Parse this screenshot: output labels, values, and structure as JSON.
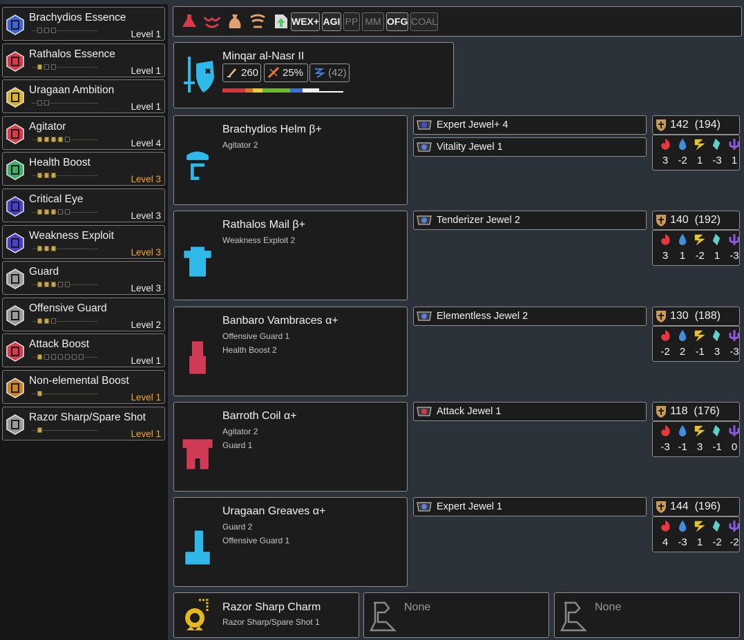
{
  "skills": [
    {
      "name": "Brachydios Essence",
      "level": "Level 1",
      "max": false,
      "pips": 3,
      "filled": 0,
      "color": "#3c63d8"
    },
    {
      "name": "Rathalos Essence",
      "level": "Level 1",
      "max": false,
      "pips": 3,
      "filled": 1,
      "color": "#d83a4c"
    },
    {
      "name": "Uragaan Ambition",
      "level": "Level 1",
      "max": false,
      "pips": 2,
      "filled": 0,
      "color": "#d7b42c"
    },
    {
      "name": "Agitator",
      "level": "Level 4",
      "max": false,
      "pips": 5,
      "filled": 4,
      "color": "#d83a4c"
    },
    {
      "name": "Health Boost",
      "level": "Level 3",
      "max": true,
      "pips": 3,
      "filled": 3,
      "color": "#3fae6b"
    },
    {
      "name": "Critical Eye",
      "level": "Level 3",
      "max": false,
      "pips": 5,
      "filled": 3,
      "color": "#4a3fc9"
    },
    {
      "name": "Weakness Exploit",
      "level": "Level 3",
      "max": true,
      "pips": 3,
      "filled": 3,
      "color": "#4a3fc9"
    },
    {
      "name": "Guard",
      "level": "Level 3",
      "max": false,
      "pips": 5,
      "filled": 3,
      "color": "#9a9a9a"
    },
    {
      "name": "Offensive Guard",
      "level": "Level 2",
      "max": false,
      "pips": 3,
      "filled": 2,
      "color": "#9a9a9a"
    },
    {
      "name": "Attack Boost",
      "level": "Level 1",
      "max": false,
      "pips": 7,
      "filled": 1,
      "color": "#d83a4c"
    },
    {
      "name": "Non-elemental Boost",
      "level": "Level 1",
      "max": true,
      "pips": 1,
      "filled": 1,
      "color": "#c8852e"
    },
    {
      "name": "Razor Sharp/Spare Shot",
      "level": "Level 1",
      "max": true,
      "pips": 1,
      "filled": 1,
      "color": "#9a9a9a"
    }
  ],
  "topbar": {
    "icons": [
      "potion-icon",
      "wing-icon",
      "sack-icon",
      "horn-icon",
      "arrow-up-icon"
    ],
    "tags": [
      {
        "label": "WEX+",
        "active": true
      },
      {
        "label": "AGI",
        "active": true
      },
      {
        "label": "PP",
        "active": false
      },
      {
        "label": "MM",
        "active": false
      },
      {
        "label": "OFG",
        "active": true
      },
      {
        "label": "COAL",
        "active": false
      }
    ]
  },
  "weapon": {
    "name": "Minqar al-Nasr II",
    "attack": "260",
    "affinity": "25%",
    "element": "(42)",
    "sharpness": [
      {
        "color": "#d0383e",
        "fraction": 0.19
      },
      {
        "color": "#d6762d",
        "fraction": 0.06
      },
      {
        "color": "#e7cf3d",
        "fraction": 0.08
      },
      {
        "color": "#6db837",
        "fraction": 0.23
      },
      {
        "color": "#3d6fd3",
        "fraction": 0.1
      },
      {
        "color": "#eeeeee",
        "fraction": 0.14
      },
      {
        "color": "#ffffff",
        "fraction": 0.2
      }
    ]
  },
  "armor": [
    {
      "name": "Brachydios Helm β+",
      "skills": [
        "Agitator 2"
      ],
      "jewels": [
        "Expert Jewel+ 4",
        "Vitality Jewel 1"
      ],
      "defense": "142",
      "defense_max": "(194)",
      "res": [
        "3",
        "-2",
        "1",
        "-3",
        "1"
      ],
      "color": "#2fb8e8"
    },
    {
      "name": "Rathalos Mail β+",
      "skills": [
        "Weakness Exploit 2"
      ],
      "jewels": [
        "Tenderizer Jewel 2"
      ],
      "defense": "140",
      "defense_max": "(192)",
      "res": [
        "3",
        "1",
        "-2",
        "1",
        "-3"
      ],
      "color": "#2fb8e8"
    },
    {
      "name": "Banbaro Vambraces α+",
      "skills": [
        "Offensive Guard 1",
        "Health Boost 2"
      ],
      "jewels": [
        "Elementless Jewel 2"
      ],
      "defense": "130",
      "defense_max": "(188)",
      "res": [
        "-2",
        "2",
        "-1",
        "3",
        "-3"
      ],
      "color": "#d13a55"
    },
    {
      "name": "Barroth Coil α+",
      "skills": [
        "Agitator 2",
        "Guard 1"
      ],
      "jewels": [
        "Attack Jewel 1"
      ],
      "defense": "118",
      "defense_max": "(176)",
      "res": [
        "-3",
        "-1",
        "3",
        "-1",
        "0"
      ],
      "color": "#d13a55"
    },
    {
      "name": "Uragaan Greaves α+",
      "skills": [
        "Guard 2",
        "Offensive Guard 1"
      ],
      "jewels": [
        "Expert Jewel 1"
      ],
      "defense": "144",
      "defense_max": "(196)",
      "res": [
        "4",
        "-3",
        "1",
        "-2",
        "-2"
      ],
      "color": "#2fb8e8"
    }
  ],
  "charm": {
    "name": "Razor Sharp Charm",
    "skill": "Razor Sharp/Spare Shot 1"
  },
  "extra_slots": [
    "None",
    "None"
  ]
}
